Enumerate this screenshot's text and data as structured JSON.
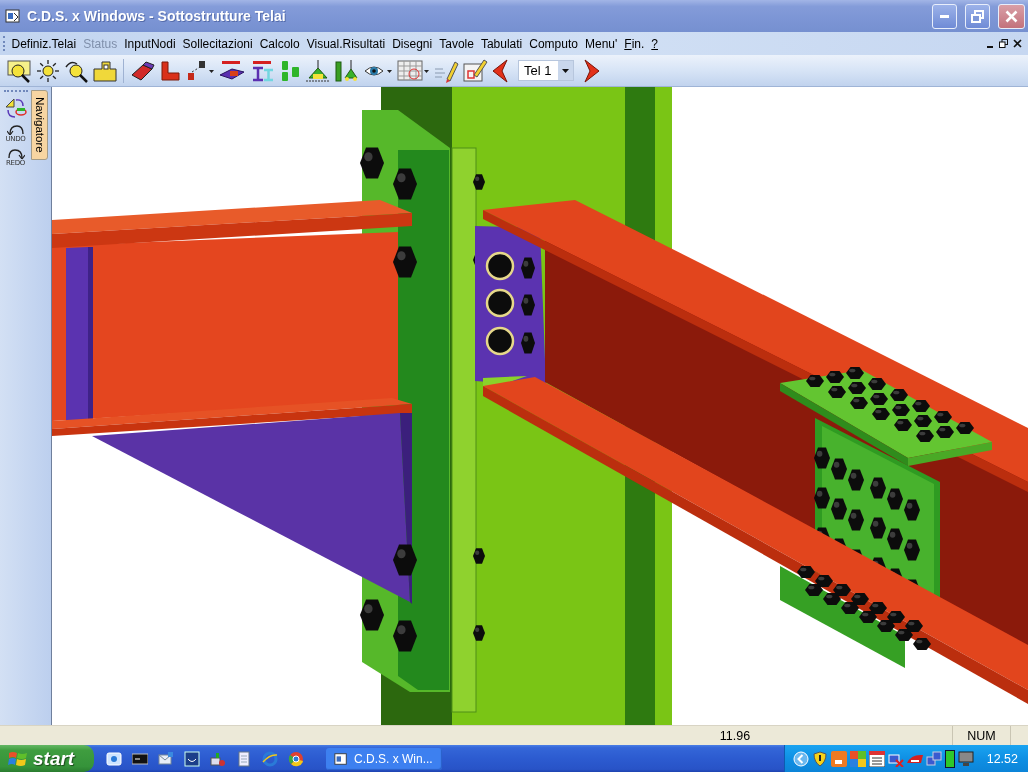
{
  "window": {
    "title": "C.D.S. x Windows - Sottostrutture Telai"
  },
  "menu_bar": {
    "items": [
      {
        "label": "Definiz.Telai",
        "disabled": false,
        "underline_first": false
      },
      {
        "label": "Status",
        "disabled": true,
        "underline_first": false
      },
      {
        "label": "InputNodi",
        "disabled": false,
        "underline_first": false
      },
      {
        "label": "Sollecitazioni",
        "disabled": false,
        "underline_first": false
      },
      {
        "label": "Calcolo",
        "disabled": false,
        "underline_first": false
      },
      {
        "label": "Visual.Risultati",
        "disabled": false,
        "underline_first": false
      },
      {
        "label": "Disegni",
        "disabled": false,
        "underline_first": false
      },
      {
        "label": "Tavole",
        "disabled": false,
        "underline_first": false
      },
      {
        "label": "Tabulati",
        "disabled": false,
        "underline_first": false
      },
      {
        "label": "Computo",
        "disabled": false,
        "underline_first": false
      },
      {
        "label": "Menu'",
        "disabled": false,
        "underline_first": false
      },
      {
        "label": "Fin.",
        "disabled": false,
        "underline_first": true
      },
      {
        "label": "?",
        "disabled": false,
        "underline_first": true
      }
    ]
  },
  "toolbar": {
    "tel_selector": {
      "value": "Tel 1"
    }
  },
  "side_panel": {
    "tab": {
      "label": "Navigatore",
      "selected": true
    },
    "tools": [
      {
        "kind": "undo",
        "label": "UNDO"
      },
      {
        "kind": "redo",
        "label": "REDO"
      }
    ]
  },
  "status_bar": {
    "panels": [
      "11.96",
      "NUM"
    ]
  },
  "taskbar": {
    "start": "start",
    "tasks": [
      {
        "label": "C.D.S. x Win...",
        "selected": false
      }
    ],
    "clock": "12.52"
  }
}
